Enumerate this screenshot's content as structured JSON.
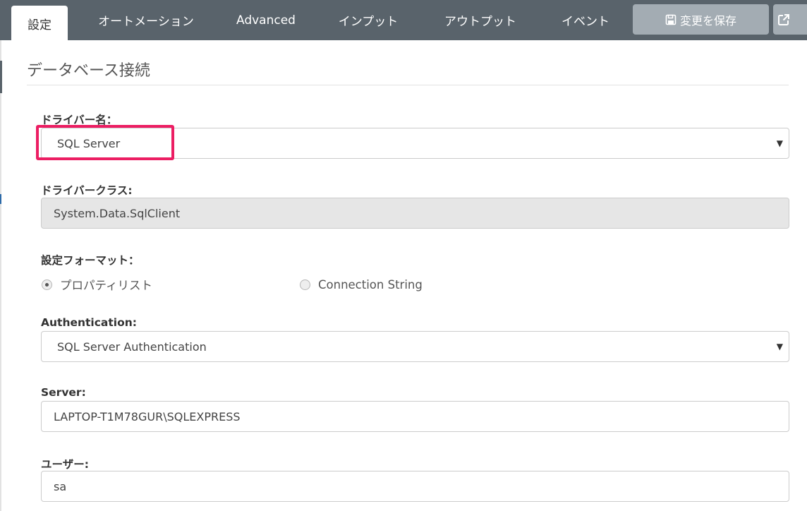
{
  "tabs": [
    {
      "label": "設定",
      "active": true
    },
    {
      "label": "オートメーション"
    },
    {
      "label": "Advanced"
    },
    {
      "label": "インプット"
    },
    {
      "label": "アウトプット"
    },
    {
      "label": "イベント"
    }
  ],
  "toolbar": {
    "save_label": "変更を保存",
    "save_icon": "floppy-disk-icon",
    "external_icon": "external-link-icon"
  },
  "section": {
    "title": "データベース接続"
  },
  "driver_name": {
    "label": "ドライバー名：",
    "value": "SQL Server"
  },
  "driver_class": {
    "label": "ドライバークラス:",
    "value": "System.Data.SqlClient"
  },
  "format": {
    "label": "設定フォーマット：",
    "options": [
      {
        "label": "プロパティリスト",
        "checked": true
      },
      {
        "label": "Connection String",
        "checked": false
      }
    ]
  },
  "authentication": {
    "label": "Authentication:",
    "value": "SQL Server Authentication"
  },
  "server": {
    "label": "Server:",
    "value": "LAPTOP-T1M78GUR\\SQLEXPRESS"
  },
  "user": {
    "label": "ユーザー:",
    "value": "sa"
  },
  "colors": {
    "tabbar": "#59636b",
    "button": "#a3acb3",
    "highlight": "#ec1e63"
  }
}
